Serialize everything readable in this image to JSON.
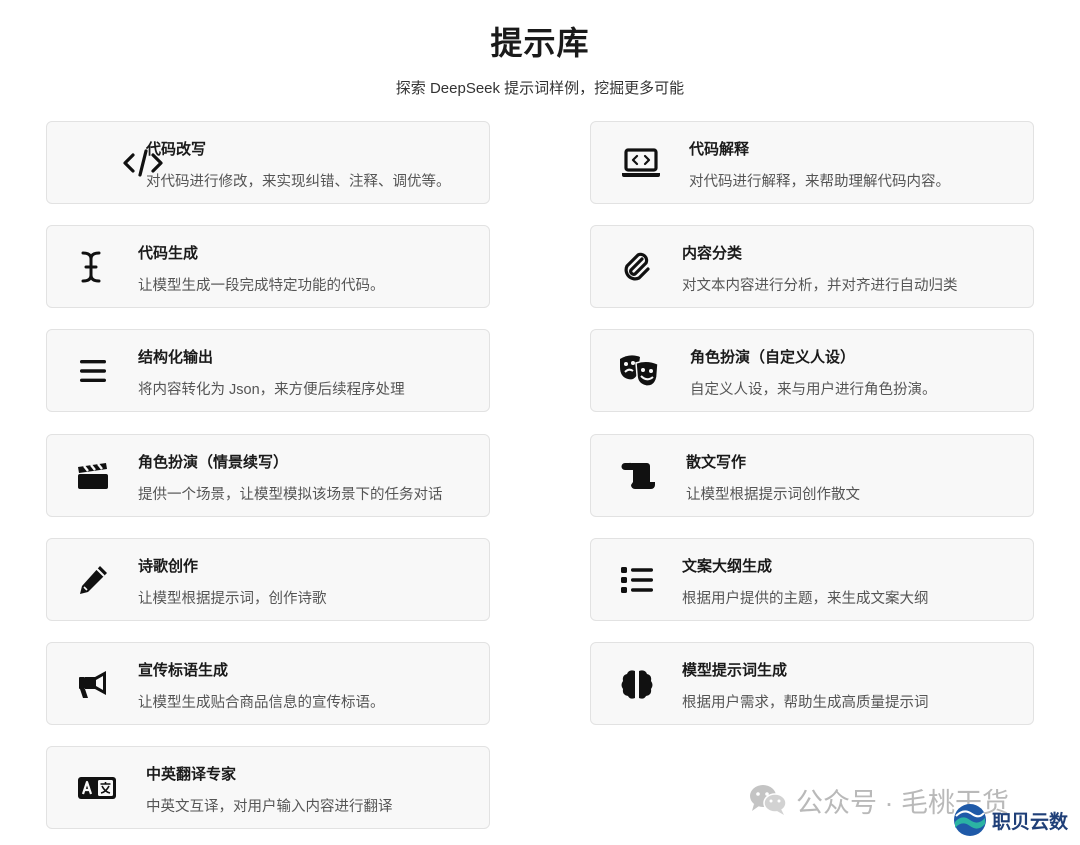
{
  "header": {
    "title": "提示库",
    "subtitle": "探索 DeepSeek 提示词样例，挖掘更多可能"
  },
  "prompts": [
    {
      "title": "代码改写",
      "desc": "对代码进行修改，来实现纠错、注释、调优等。",
      "icon": "code-icon"
    },
    {
      "title": "代码解释",
      "desc": "对代码进行解释，来帮助理解代码内容。",
      "icon": "laptop-code-icon"
    },
    {
      "title": "代码生成",
      "desc": "让模型生成一段完成特定功能的代码。",
      "icon": "cursor-icon"
    },
    {
      "title": "内容分类",
      "desc": "对文本内容进行分析，并对齐进行自动归类",
      "icon": "paperclip-icon"
    },
    {
      "title": "结构化输出",
      "desc": "将内容转化为 Json，来方便后续程序处理",
      "icon": "bars-icon"
    },
    {
      "title": "角色扮演（自定义人设）",
      "desc": "自定义人设，来与用户进行角色扮演。",
      "icon": "masks-icon"
    },
    {
      "title": "角色扮演（情景续写）",
      "desc": "提供一个场景，让模型模拟该场景下的任务对话",
      "icon": "clapperboard-icon"
    },
    {
      "title": "散文写作",
      "desc": "让模型根据提示词创作散文",
      "icon": "scroll-icon"
    },
    {
      "title": "诗歌创作",
      "desc": "让模型根据提示词，创作诗歌",
      "icon": "pencil-icon"
    },
    {
      "title": "文案大纲生成",
      "desc": "根据用户提供的主题，来生成文案大纲",
      "icon": "list-icon"
    },
    {
      "title": "宣传标语生成",
      "desc": "让模型生成贴合商品信息的宣传标语。",
      "icon": "megaphone-icon"
    },
    {
      "title": "模型提示词生成",
      "desc": "根据用户需求，帮助生成高质量提示词",
      "icon": "brain-icon"
    },
    {
      "title": "中英翻译专家",
      "desc": "中英文互译，对用户输入内容进行翻译",
      "icon": "translate-icon"
    }
  ],
  "watermark": {
    "text": "公众号 · 毛桃干货",
    "brand": "职贝云数"
  }
}
